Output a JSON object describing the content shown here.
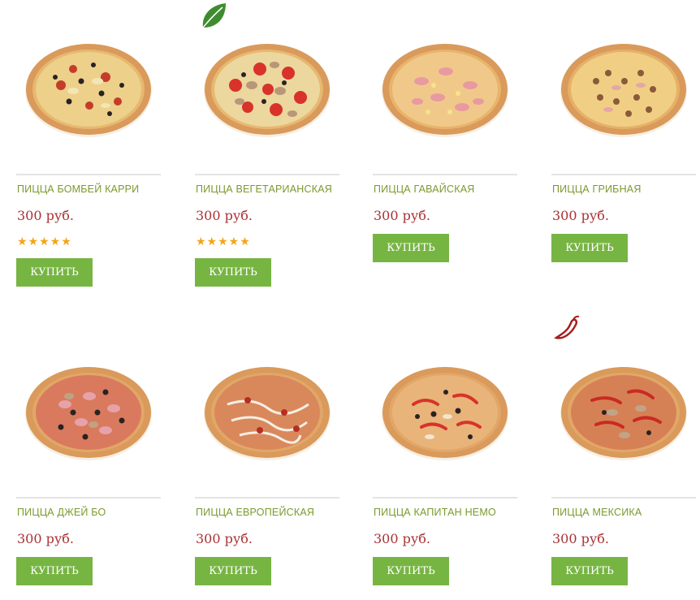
{
  "products": [
    {
      "name": "ПИЦЦА БОМБЕЙ КАРРИ",
      "price": "300 руб.",
      "rating": "★★★★★",
      "buy_label": "КУПИТЬ",
      "badge": ""
    },
    {
      "name": "ПИЦЦА ВЕГЕТАРИАНСКАЯ",
      "price": "300 руб.",
      "rating": "★★★★★",
      "buy_label": "КУПИТЬ",
      "badge": "leaf-icon"
    },
    {
      "name": "ПИЦЦА ГАВАЙСКАЯ",
      "price": "300 руб.",
      "rating": "",
      "buy_label": "КУПИТЬ",
      "badge": ""
    },
    {
      "name": "ПИЦЦА ГРИБНАЯ",
      "price": "300 руб.",
      "rating": "",
      "buy_label": "КУПИТЬ",
      "badge": ""
    },
    {
      "name": "ПИЦЦА ДЖЕЙ БО",
      "price": "300 руб.",
      "rating": "",
      "buy_label": "КУПИТЬ",
      "badge": ""
    },
    {
      "name": "ПИЦЦА ЕВРОПЕЙСКАЯ",
      "price": "300 руб.",
      "rating": "",
      "buy_label": "КУПИТЬ",
      "badge": ""
    },
    {
      "name": "ПИЦЦА КАПИТАН НЕМО",
      "price": "300 руб.",
      "rating": "",
      "buy_label": "КУПИТЬ",
      "badge": ""
    },
    {
      "name": "ПИЦЦА МЕКСИКА",
      "price": "300 руб.",
      "rating": "",
      "buy_label": "КУПИТЬ",
      "badge": "chili-pepper-icon"
    }
  ],
  "colors": {
    "title": "#7a9a2c",
    "price": "#a83235",
    "star": "#f3a514",
    "button": "#77b543",
    "leaf": "#3f8c2f",
    "chili": "#a51d1d"
  }
}
